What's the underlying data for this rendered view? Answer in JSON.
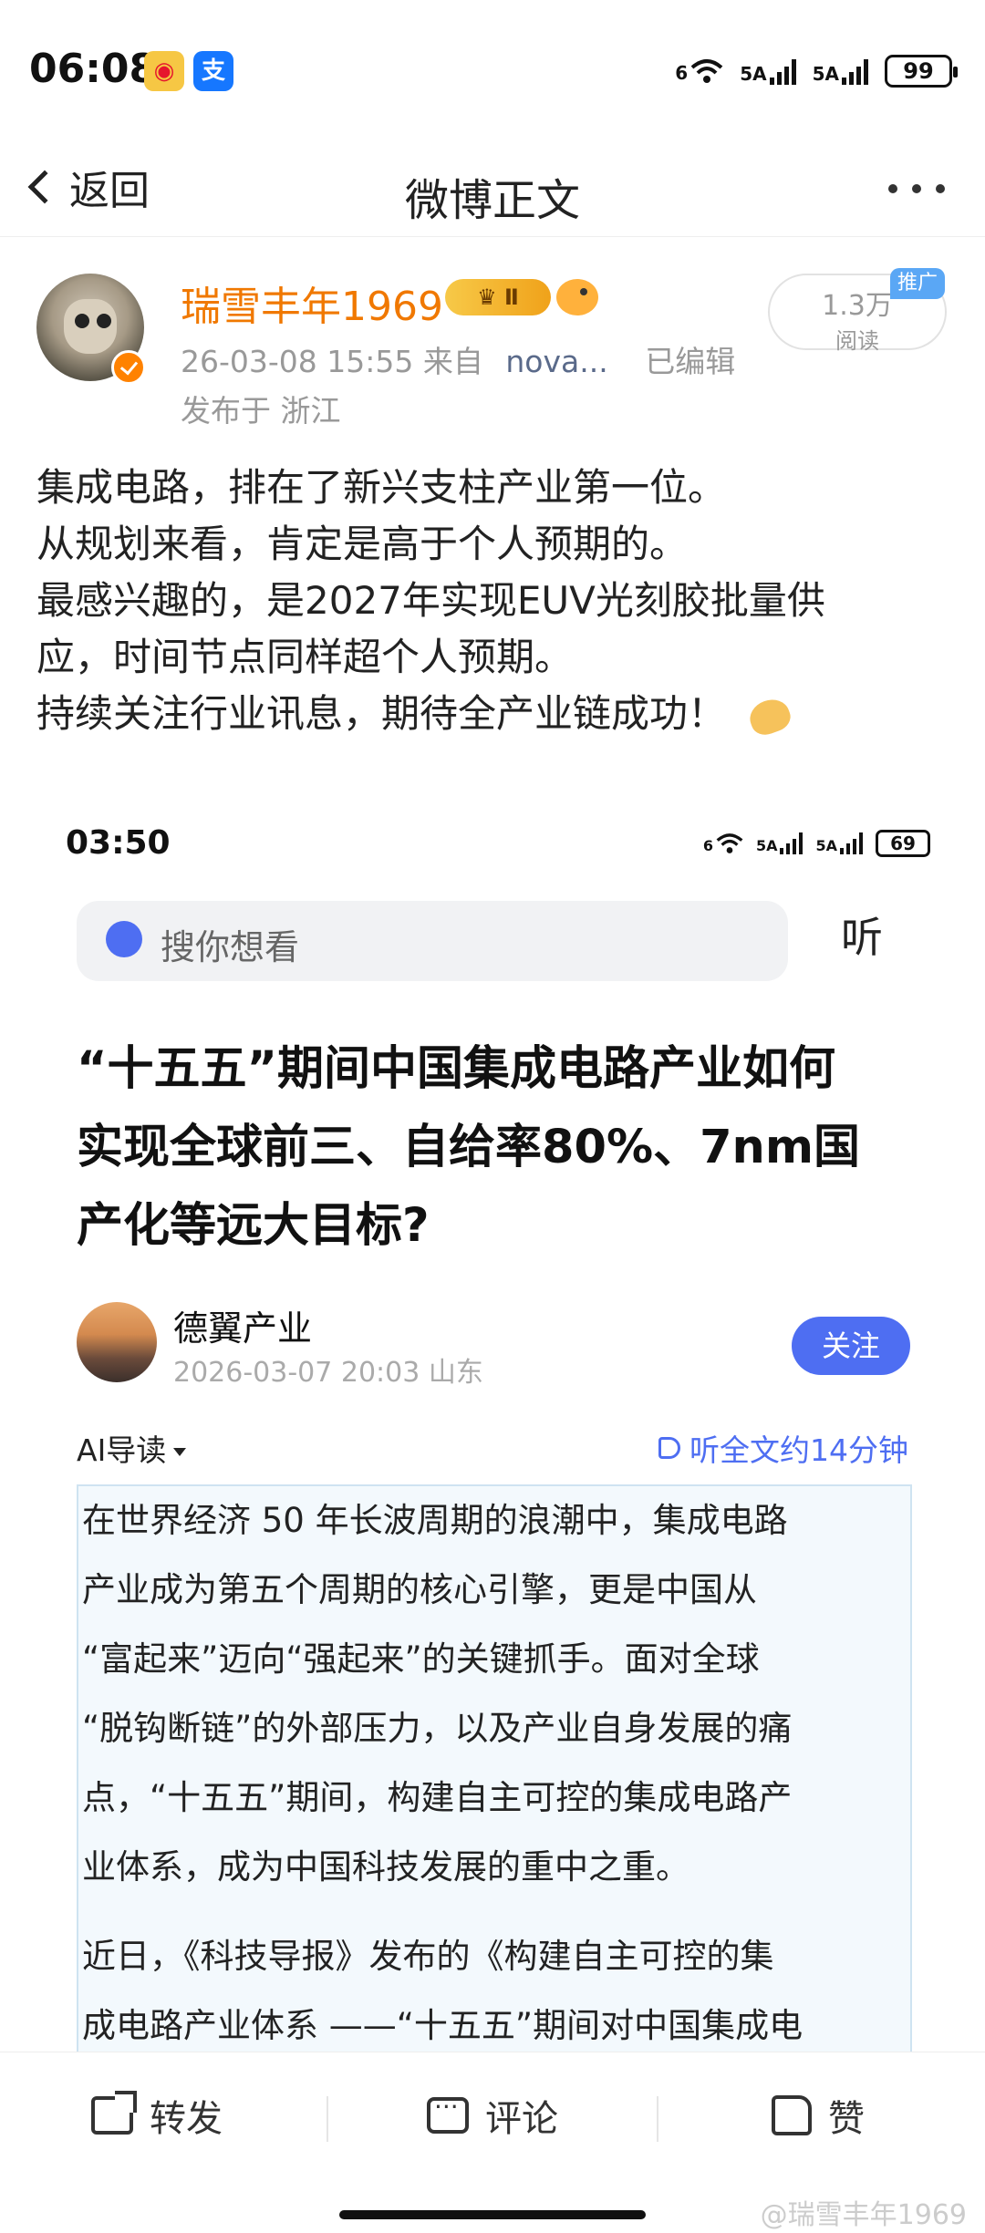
{
  "status_bar": {
    "time": "06:08",
    "app_icons": [
      "weibo-icon",
      "alipay-icon"
    ],
    "alipay_glyph": "支",
    "network": [
      "6",
      "5A",
      "5A"
    ],
    "battery": "99"
  },
  "nav": {
    "back_label": "返回",
    "title": "微博正文"
  },
  "post": {
    "author": "瑞雪丰年1969",
    "member_badge": "Ⅱ",
    "meta": {
      "time": "26-03-08 15:55",
      "from_label": "来自",
      "source": "nova...",
      "edited": "已编辑",
      "location": "发布于 浙江"
    },
    "reads": {
      "count": "1.3万",
      "label": "阅读",
      "promo_tag": "推广"
    },
    "lines": [
      "集成电路，排在了新兴支柱产业第一位。",
      "从规划来看，肯定是高于个人预期的。",
      "最感兴趣的，是2027年实现EUV光刻胶批量供",
      "应，时间节点同样超个人预期。",
      "持续关注行业讯息，期待全产业链成功！"
    ]
  },
  "embed": {
    "time": "03:50",
    "network": [
      "6",
      "5A",
      "5A"
    ],
    "battery": "69",
    "search_placeholder": "搜你想看",
    "listen_label": "听",
    "headline": [
      "“十五五”期间中国集成电路产业如何",
      "实现全球前三、自给率80%、7nm国",
      "产化等远大目标?"
    ],
    "author": "德翼产业",
    "date": "2026-03-07 20:03  山东",
    "follow_label": "关注",
    "ai_label": "AI导读",
    "listen_all": "听全文约14分钟",
    "body_para1": [
      "在世界经济 50 年长波周期的浪潮中，集成电路",
      "产业成为第五个周期的核心引擎，更是中国从",
      "“富起来”迈向“强起来”的关键抓手。面对全球",
      "“脱钩断链”的外部压力，以及产业自身发展的痛",
      "点，“十五五”期间，构建自主可控的集成电路产",
      "业体系，成为中国科技发展的重中之重。"
    ],
    "body_para2": [
      "近日，《科技导报》发布的《构建自主可控的集",
      "成电路产业体系 ——“十五五”期间对中国集成电"
    ]
  },
  "toolbar": {
    "repost": "转发",
    "comment": "评论",
    "like": "赞"
  },
  "watermark": "@瑞雪丰年1969",
  "colors": {
    "author_orange": "#f07800",
    "follow_blue": "#4e6ef2",
    "promo_blue": "#5aa7f5"
  }
}
